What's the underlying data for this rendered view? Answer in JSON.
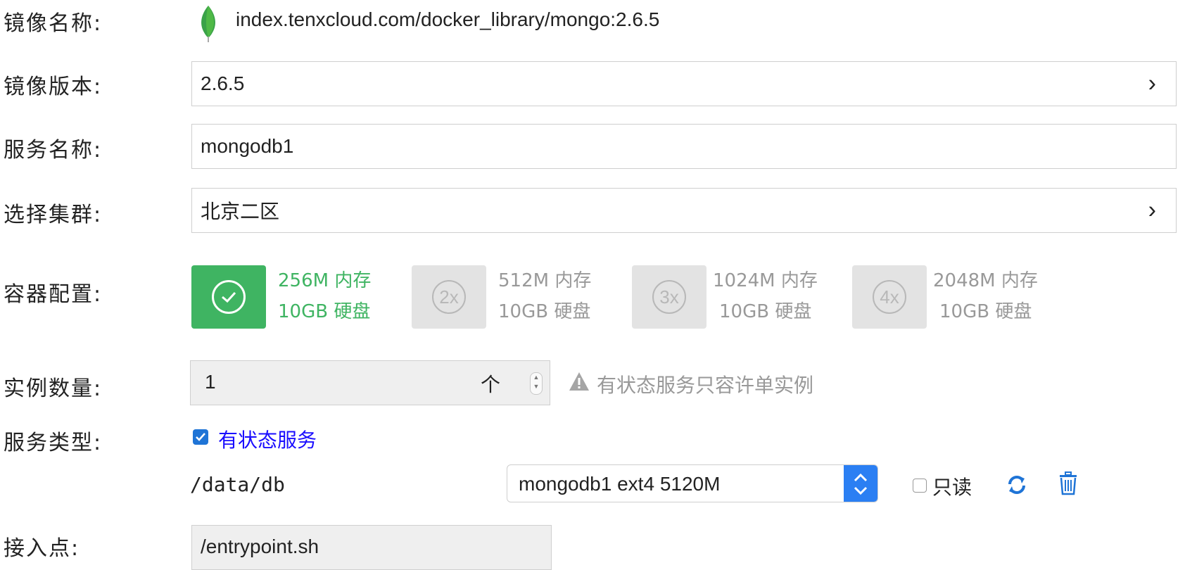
{
  "image": {
    "label": "镜像名称:",
    "value": "index.tenxcloud.com/docker_library/mongo:2.6.5",
    "logo_icon": "mongodb-leaf-icon"
  },
  "version": {
    "label": "镜像版本:",
    "value": "2.6.5"
  },
  "service_name": {
    "label": "服务名称:",
    "value": "mongodb1"
  },
  "cluster": {
    "label": "选择集群:",
    "value": "北京二区"
  },
  "container_config": {
    "label": "容器配置:",
    "options": [
      {
        "badge": "",
        "memory": "256M 内存",
        "disk": "10GB 硬盘",
        "selected": true
      },
      {
        "badge": "2x",
        "memory": "512M 内存",
        "disk": "10GB 硬盘",
        "selected": false
      },
      {
        "badge": "3x",
        "memory": "1024M 内存",
        "disk": "10GB 硬盘",
        "selected": false
      },
      {
        "badge": "4x",
        "memory": "2048M 内存",
        "disk": "10GB 硬盘",
        "selected": false
      }
    ],
    "accent": "#3fb462"
  },
  "instances": {
    "label": "实例数量:",
    "value": "1",
    "unit": "个",
    "warning": "有状态服务只容许单实例"
  },
  "service_type": {
    "label": "服务类型:",
    "checkbox_label": "有状态服务",
    "checked": true
  },
  "volume": {
    "path": "/data/db",
    "select_value": "mongodb1 ext4 5120M",
    "readonly_label": "只读",
    "readonly_checked": false
  },
  "entrypoint": {
    "label": "接入点:",
    "value": "/entrypoint.sh"
  },
  "colors": {
    "select_arrow": "#2b7ff3",
    "link_blue": "#1a0dff",
    "icon_blue": "#1f74d6"
  }
}
